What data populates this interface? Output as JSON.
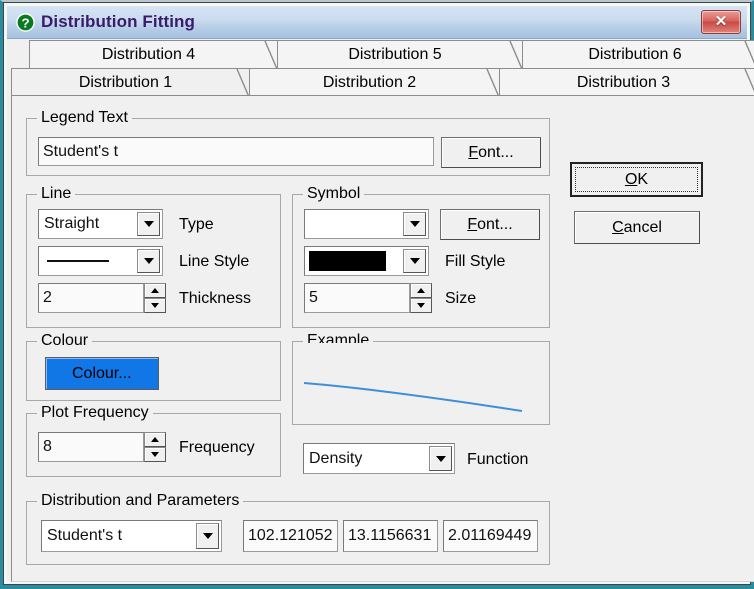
{
  "window": {
    "title": "Distribution Fitting",
    "help_icon": "question-mark-icon",
    "close_label": "✕"
  },
  "tabs": {
    "top_row": [
      {
        "label": "Distribution 4"
      },
      {
        "label": "Distribution 5"
      },
      {
        "label": "Distribution 6"
      }
    ],
    "bottom_row": [
      {
        "label": "Distribution 1",
        "selected": true
      },
      {
        "label": "Distribution 2"
      },
      {
        "label": "Distribution 3"
      }
    ]
  },
  "legend_text": {
    "group_label": "Legend Text",
    "value": "Student's t",
    "placeholder": "",
    "font_button": {
      "pre": "F",
      "post": "ont..."
    }
  },
  "line": {
    "group_label": "Line",
    "type_value": "Straight",
    "type_label": "Type",
    "style_label": "Line Style",
    "style_value": "solid-line",
    "thickness_value": "2",
    "thickness_label": "Thickness"
  },
  "symbol": {
    "group_label": "Symbol",
    "symbol_value": "",
    "font_button": {
      "pre": "F",
      "post": "ont..."
    },
    "fill_style_label": "Fill Style",
    "fill_style_colour": "#000000",
    "size_value": "5",
    "size_label": "Size"
  },
  "colour": {
    "group_label": "Colour",
    "button_label": "Colour...",
    "button_colour": "#1176e6"
  },
  "plot_frequency": {
    "group_label": "Plot Frequency",
    "value": "8",
    "label": "Frequency"
  },
  "example": {
    "group_label": "Example",
    "curve_colour": "#3f8fd8"
  },
  "function": {
    "value": "Density",
    "label": "Function"
  },
  "distribution_and_parameters": {
    "group_label": "Distribution and Parameters",
    "distribution_value": "Student's t",
    "parameters": [
      "102.121052",
      "13.1156631",
      "2.01169449"
    ]
  },
  "buttons": {
    "ok": {
      "pre": "O",
      "post": "K"
    },
    "cancel": {
      "pre": "C",
      "post": "ancel"
    }
  }
}
